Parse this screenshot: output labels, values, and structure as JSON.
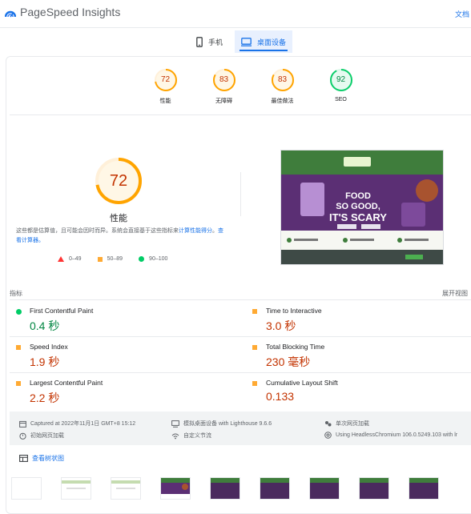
{
  "header": {
    "title": "PageSpeed Insights",
    "right_link": "文档"
  },
  "tabs": [
    {
      "label": "手机",
      "icon": "phone-icon",
      "active": false
    },
    {
      "label": "桌面设备",
      "icon": "desktop-icon",
      "active": true
    }
  ],
  "scores": [
    {
      "label": "性能",
      "value": "72",
      "color": "#ffa400"
    },
    {
      "label": "无障碍",
      "value": "83",
      "color": "#ffa400"
    },
    {
      "label": "最佳做法",
      "value": "83",
      "color": "#ffa400"
    },
    {
      "label": "SEO",
      "value": "92",
      "color": "#0cce6b"
    }
  ],
  "performance": {
    "score": "72",
    "title": "性能",
    "desc_prefix": "这些都是估算值，且可能会因时而异。系统会直接基于这些指标来",
    "desc_link1": "计算性能得分",
    "desc_mid": "。",
    "desc_link2": "查看计算器。",
    "legend": [
      {
        "range": "0–49",
        "shape": "triangle-red"
      },
      {
        "range": "50–89",
        "shape": "square-orange"
      },
      {
        "range": "90–100",
        "shape": "circle-green"
      }
    ]
  },
  "screenshot": {
    "hero_line1": "FOOD",
    "hero_line2": "SO GOOD,",
    "hero_line3": "IT'S SCARY"
  },
  "metrics": {
    "header": "指标",
    "expand": "展开视图",
    "items": [
      {
        "name": "First Contentful Paint",
        "value": "0.4 秒",
        "rating": "good"
      },
      {
        "name": "Time to Interactive",
        "value": "3.0 秒",
        "rating": "average"
      },
      {
        "name": "Speed Index",
        "value": "1.9 秒",
        "rating": "average"
      },
      {
        "name": "Total Blocking Time",
        "value": "230 毫秒",
        "rating": "average"
      },
      {
        "name": "Largest Contentful Paint",
        "value": "2.2 秒",
        "rating": "average"
      },
      {
        "name": "Cumulative Layout Shift",
        "value": "0.133",
        "rating": "average"
      }
    ]
  },
  "run_info": {
    "captured": "Captured at 2022年11月1日 GMT+8 15:12",
    "device": "模拟桌面设备 with Lighthouse 9.6.6",
    "session": "单次网页加载",
    "initial_load": "初始网页加载",
    "throttling": "自定义节流",
    "browser": "Using HeadlessChromium 106.0.5249.103 with lr"
  },
  "treemap": {
    "label": "查看树状图"
  },
  "colors": {
    "accent": "#1a73e8",
    "good": "#018642",
    "average": "#c33300",
    "average_ring": "#ffa400"
  }
}
